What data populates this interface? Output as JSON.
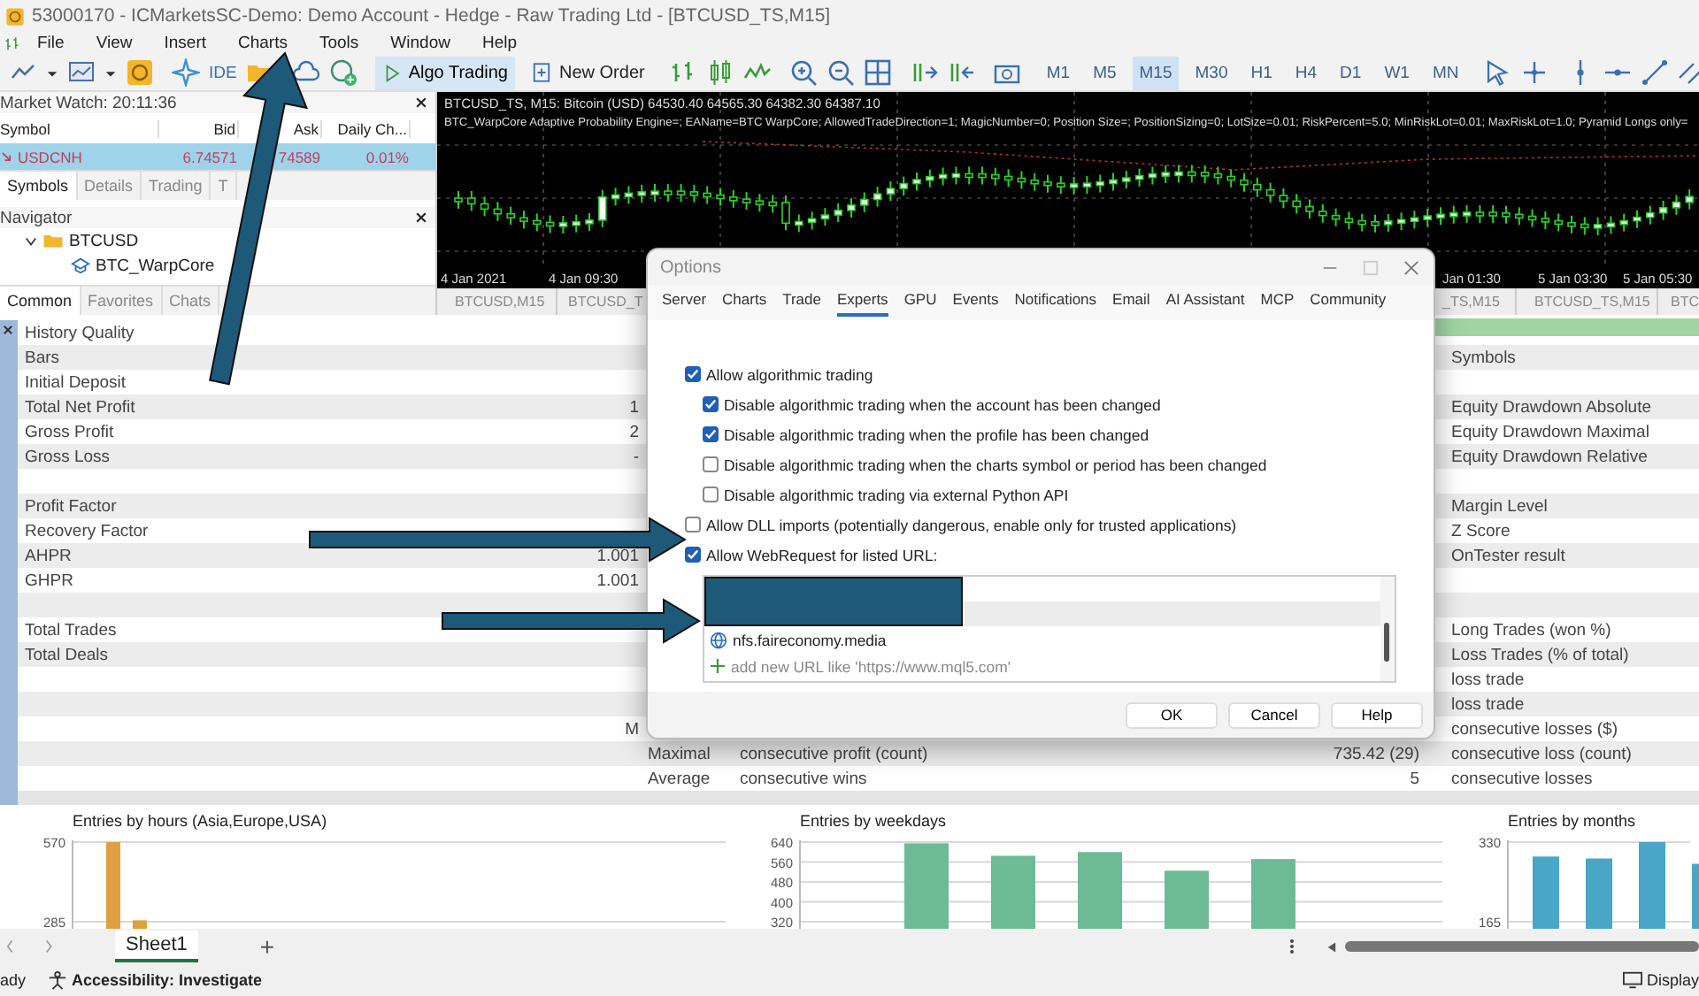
{
  "window": {
    "title": "53000170 - ICMarketsSC-Demo: Demo Account - Hedge - Raw Trading Ltd - [BTCUSD_TS,M15]"
  },
  "menu": [
    "File",
    "View",
    "Insert",
    "Charts",
    "Tools",
    "Window",
    "Help"
  ],
  "toolbar": {
    "ide": "IDE",
    "algo_trading": {
      "label": "Algo Trading",
      "on": true
    },
    "new_order": "New Order",
    "timeframes": [
      {
        "label": "M1",
        "selected": false
      },
      {
        "label": "M5",
        "selected": false
      },
      {
        "label": "M15",
        "selected": true
      },
      {
        "label": "M30",
        "selected": false
      },
      {
        "label": "H1",
        "selected": false
      },
      {
        "label": "H4",
        "selected": false
      },
      {
        "label": "D1",
        "selected": false
      },
      {
        "label": "W1",
        "selected": false
      },
      {
        "label": "MN",
        "selected": false
      }
    ]
  },
  "market_watch": {
    "title": "Market Watch: 20:11:36",
    "columns": [
      "Symbol",
      "Bid",
      "Ask",
      "Daily Ch..."
    ],
    "rows": [
      {
        "symbol": "USDCNH",
        "bid": "6.74571",
        "ask": "74589",
        "change": "0.01%",
        "selected": true
      }
    ],
    "tabs": [
      {
        "label": "Symbols",
        "selected": true
      },
      {
        "label": "Details",
        "selected": false
      },
      {
        "label": "Trading",
        "selected": false
      },
      {
        "label": "T",
        "selected": false
      }
    ]
  },
  "navigator": {
    "title": "Navigator",
    "tree": [
      {
        "label": "BTCUSD",
        "expanded": true,
        "children": [
          {
            "label": "BTC_WarpCore"
          }
        ]
      }
    ],
    "tabs": [
      {
        "label": "Common",
        "selected": true
      },
      {
        "label": "Favorites",
        "selected": false
      },
      {
        "label": "Chats",
        "selected": false
      }
    ]
  },
  "chart": {
    "header": "BTCUSD_TS, M15:  Bitcoin (USD)  64530.40 64565.30 64382.30 64387.10",
    "parameters": "BTC_WarpCore Adaptive Probability Engine=; EAName=BTC WarpCore; AllowedTradeDirection=1; MagicNumber=0; Position Size=; PositionSizing=0; LotSize=0.01; RiskPercent=5.0; MinRiskLot=0.01; MaxRiskLot=1.0; Pyramid Longs only=",
    "time_labels": [
      "4 Jan 2021",
      "4 Jan 09:30",
      "Jan 01:30",
      "5 Jan 03:30",
      "5 Jan 05:30"
    ],
    "tabs": [
      "BTCUSD,M15",
      "BTCUSD_T",
      "_TS,M15",
      "BTCUSD_TS,M15",
      "BTC"
    ]
  },
  "report": {
    "rows": [
      {
        "label": "History Quality"
      },
      {
        "label": "Bars",
        "column_6": "Symbols"
      },
      {
        "label": "Initial Deposit"
      },
      {
        "label": "Total Net Profit",
        "value": "1",
        "column_6": "Equity Drawdown Absolute"
      },
      {
        "label": "Gross Profit",
        "value": "2",
        "column_6": "Equity Drawdown Maximal"
      },
      {
        "label": "Gross Loss",
        "value": "-",
        "column_6": "Equity Drawdown Relative"
      },
      {},
      {
        "label": "Profit Factor",
        "column_6": "Margin Level"
      },
      {
        "label": "Recovery Factor",
        "column_6": "Z Score"
      },
      {
        "label": "AHPR",
        "value": "1.001",
        "column_6": "OnTester result"
      },
      {
        "label": "GHPR",
        "value": "1.001"
      },
      {},
      {
        "label": "Total Trades",
        "column_6": "Long Trades (won %)"
      },
      {
        "label": "Total Deals",
        "column_6": "Loss Trades (% of total)"
      },
      {
        "column_6": "loss trade"
      },
      {
        "column_6": "loss trade"
      },
      {
        "value": "M",
        "column_6": "consecutive losses ($)"
      },
      {
        "column_3": "Maximal",
        "column_4": "consecutive profit (count)",
        "column_5": "735.42 (29)",
        "column_6": "consecutive loss (count)"
      },
      {
        "column_3": "Average",
        "column_4": "consecutive wins",
        "column_5": "5",
        "column_6": "consecutive losses"
      }
    ]
  },
  "charts": [
    {
      "chart_data": {
        "type": "bar",
        "title": "Entries by hours (Asia,Europe,USA)",
        "ylim": [
          0,
          570
        ],
        "yticks": [
          570,
          285
        ],
        "grid": true,
        "series": [
          {
            "color": "#e0a040",
            "values": [
              570,
              290
            ]
          }
        ]
      }
    },
    {
      "chart_data": {
        "type": "bar",
        "title": "Entries by weekdays",
        "ylim": [
          0,
          640
        ],
        "yticks": [
          640,
          560,
          480,
          400,
          320
        ],
        "grid": true,
        "series": [
          {
            "color": "#6dbb94",
            "values": [
              635,
              585,
              600,
              525,
              572
            ]
          }
        ]
      }
    },
    {
      "chart_data": {
        "type": "bar",
        "title": "Entries by months",
        "ylim": [
          0,
          330
        ],
        "yticks": [
          330,
          165
        ],
        "grid": true,
        "series": [
          {
            "color": "#49a6c6",
            "values": [
              300,
              296,
              330,
              285
            ]
          }
        ]
      }
    }
  ],
  "sheet_tabs": {
    "tabs": [
      {
        "label": "Sheet1",
        "selected": true
      }
    ],
    "add": "+"
  },
  "status_bar": {
    "mode": "ady",
    "accessibility": "Accessibility: Investigate",
    "display": "Display"
  },
  "dialog": {
    "title": "Options",
    "tabs": [
      {
        "label": "Server",
        "selected": false
      },
      {
        "label": "Charts",
        "selected": false
      },
      {
        "label": "Trade",
        "selected": false
      },
      {
        "label": "Experts",
        "selected": true
      },
      {
        "label": "GPU",
        "selected": false
      },
      {
        "label": "Events",
        "selected": false
      },
      {
        "label": "Notifications",
        "selected": false
      },
      {
        "label": "Email",
        "selected": false
      },
      {
        "label": "AI Assistant",
        "selected": false
      },
      {
        "label": "MCP",
        "selected": false
      },
      {
        "label": "Community",
        "selected": false
      }
    ],
    "options": [
      {
        "label": "Allow algorithmic trading",
        "checked": true,
        "children": [
          {
            "label": "Disable algorithmic trading when the account has been changed",
            "checked": true
          },
          {
            "label": "Disable algorithmic trading when the profile has been changed",
            "checked": true
          },
          {
            "label": "Disable algorithmic trading when the charts symbol or period has been changed",
            "checked": false
          },
          {
            "label": "Disable algorithmic trading via external Python API",
            "checked": false
          }
        ]
      },
      {
        "label": "Allow DLL imports (potentially dangerous, enable only for trusted applications)",
        "checked": false
      },
      {
        "label": "Allow WebRequest for listed URL:",
        "checked": true
      }
    ],
    "url_list": {
      "rows": [
        {
          "kind": "redacted"
        },
        {
          "kind": "url",
          "url": "nfs.faireconomy.media"
        }
      ],
      "placeholder": "add new URL like 'https://www.mql5.com'"
    },
    "buttons": [
      "OK",
      "Cancel",
      "Help"
    ]
  }
}
